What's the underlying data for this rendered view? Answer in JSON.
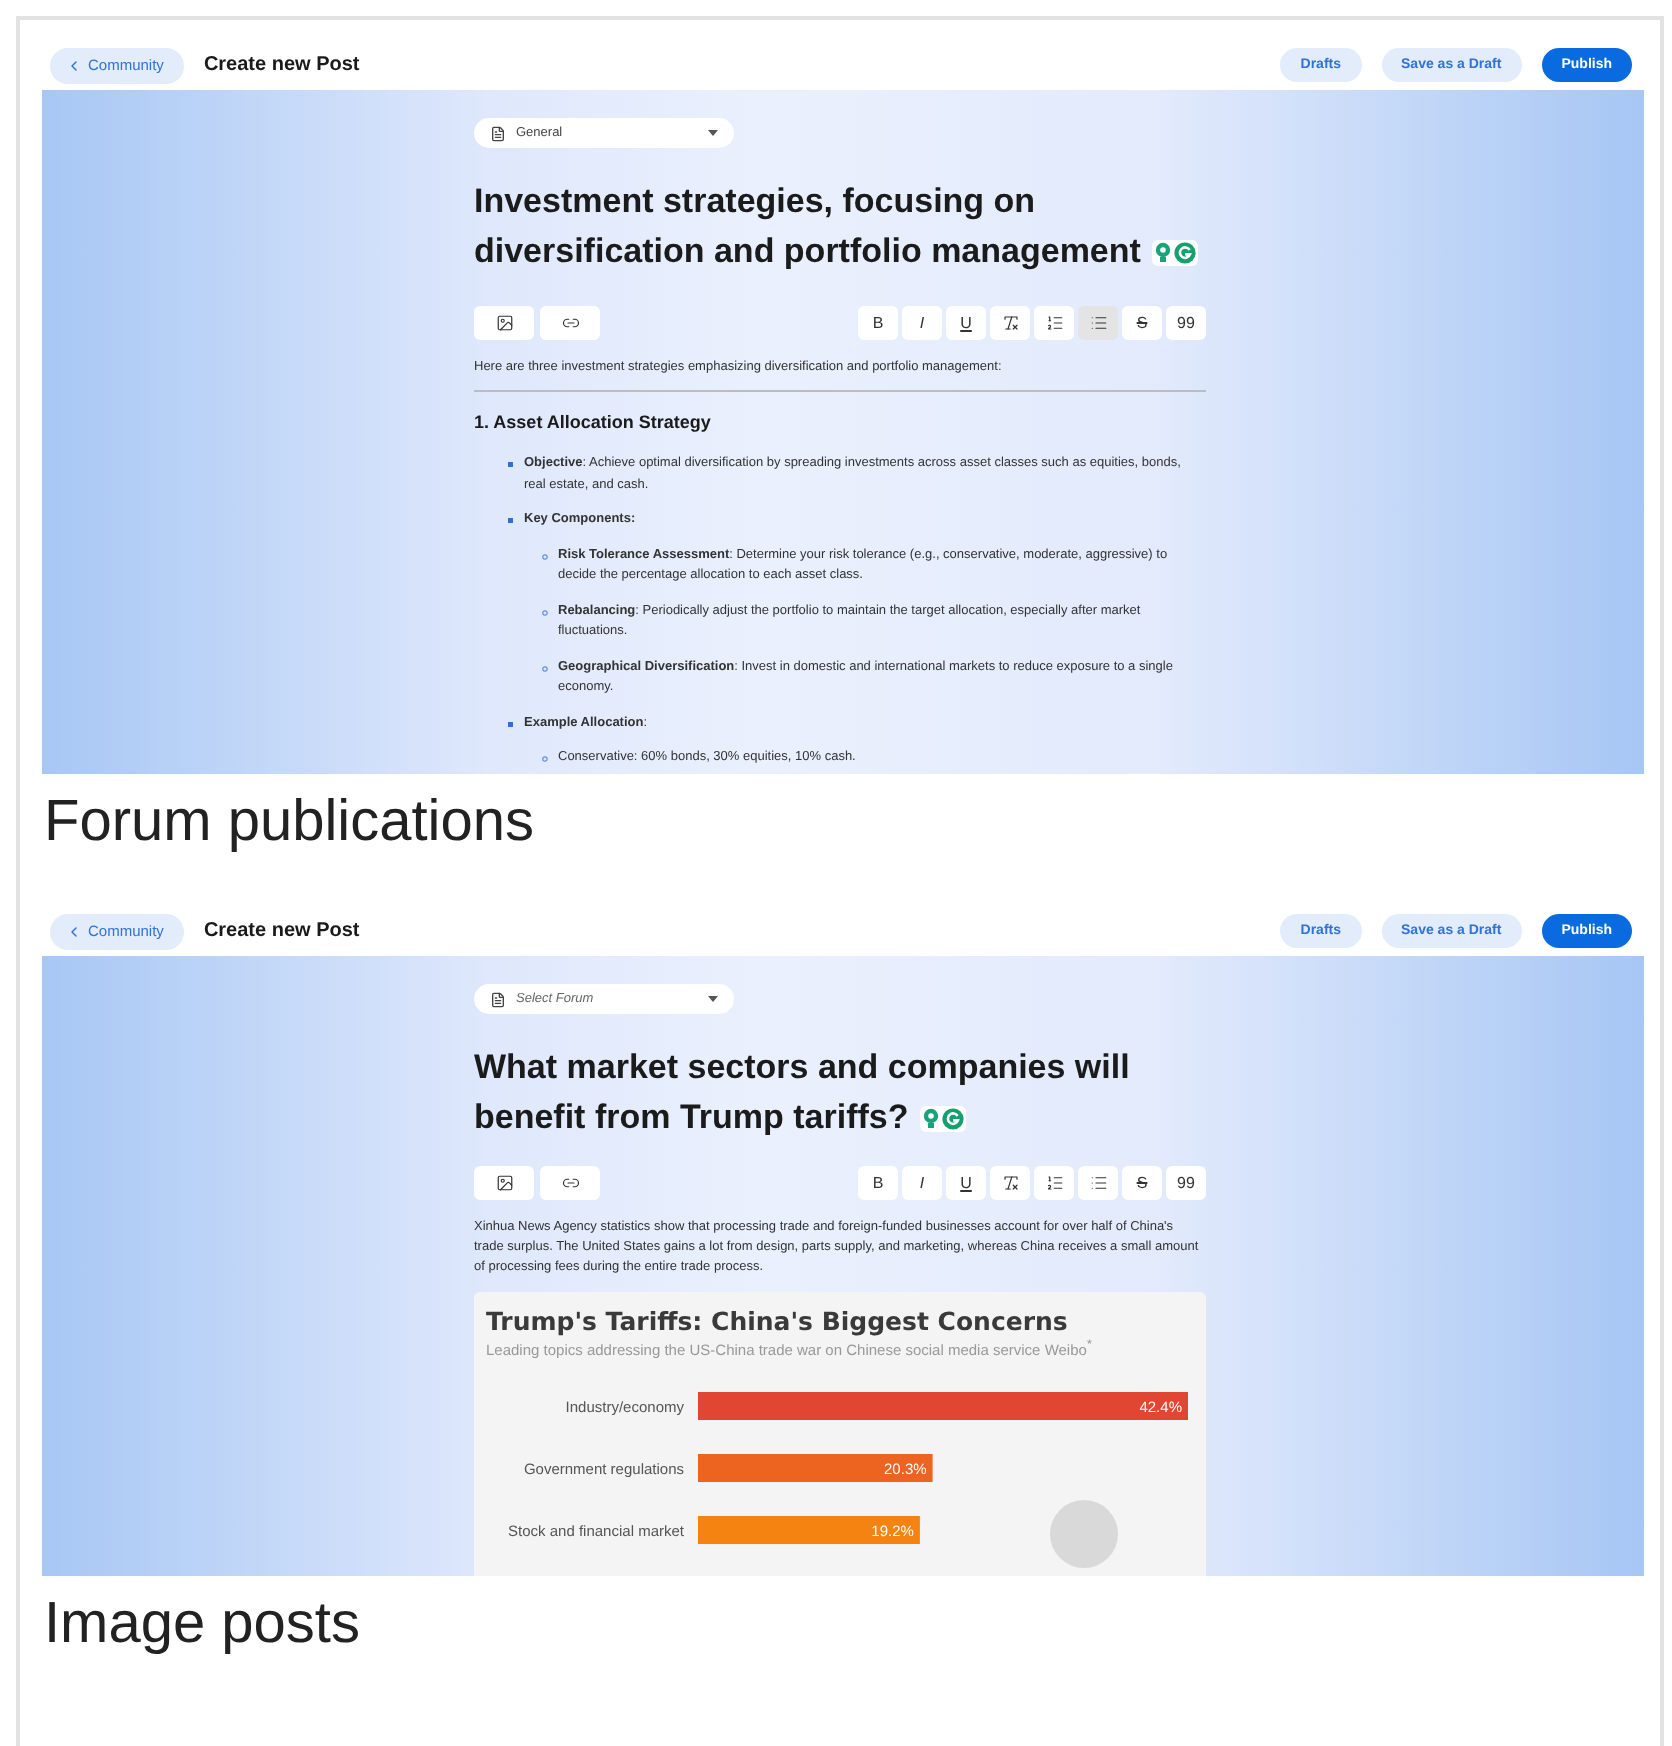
{
  "panels": [
    {
      "header": {
        "back_label": "Community",
        "title": "Create new Post",
        "buttons": [
          {
            "label": "Drafts",
            "kind": "secondary"
          },
          {
            "label": "Save as a Draft",
            "kind": "secondary"
          },
          {
            "label": "Publish",
            "kind": "primary"
          }
        ]
      },
      "forum_select": {
        "value": "General"
      },
      "post_title": "Investment strategies, focusing on diversification and portfolio management",
      "insert_tools": [
        {
          "kind": "image"
        },
        {
          "kind": "link"
        }
      ],
      "format_tools": [
        {
          "kind": "bold",
          "label": "B",
          "active": false
        },
        {
          "kind": "italic",
          "label": "I",
          "active": false
        },
        {
          "kind": "underline",
          "label": "U",
          "active": false
        },
        {
          "kind": "clear-format",
          "active": false
        },
        {
          "kind": "ordered-list",
          "active": false
        },
        {
          "kind": "bullet-list",
          "active": true
        },
        {
          "kind": "strike",
          "label": "S",
          "active": false
        },
        {
          "kind": "quote",
          "label": "99",
          "active": false
        }
      ],
      "body": [
        {
          "kind": "paragraph",
          "text": "Here are three investment strategies emphasizing diversification and portfolio management:"
        },
        {
          "kind": "rule"
        },
        {
          "kind": "heading",
          "text": "1. Asset Allocation Strategy"
        },
        {
          "kind": "list",
          "items": [
            {
              "text": "**Objective**: Achieve optimal diversification by spreading investments across asset classes such as equities, bonds, real estate, and cash."
            },
            {
              "text": "**Key Components:**",
              "children": [
                {
                  "text": "**Risk Tolerance Assessment**: Determine your risk tolerance (e.g., conservative, moderate, aggressive) to decide the percentage allocation to each asset class."
                },
                {
                  "text": "**Rebalancing**: Periodically adjust the portfolio to maintain the target allocation, especially after market fluctuations."
                },
                {
                  "text": "**Geographical Diversification**: Invest in domestic and international markets to reduce exposure to a single economy."
                }
              ]
            },
            {
              "text": "**Example Allocation**:",
              "children": [
                {
                  "text": "Conservative: 60% bonds, 30% equities, 10% cash."
                }
              ]
            }
          ]
        }
      ],
      "caption": "Forum publications"
    },
    {
      "header": {
        "back_label": "Community",
        "title": "Create new Post",
        "buttons": [
          {
            "label": "Drafts",
            "kind": "secondary"
          },
          {
            "label": "Save as a Draft",
            "kind": "secondary"
          },
          {
            "label": "Publish",
            "kind": "primary"
          }
        ]
      },
      "forum_select": {
        "placeholder": "Select Forum"
      },
      "post_title": "What market sectors and companies will benefit from Trump tariffs?",
      "insert_tools": [
        {
          "kind": "image"
        },
        {
          "kind": "link"
        }
      ],
      "format_tools": [
        {
          "kind": "bold",
          "label": "B",
          "active": false
        },
        {
          "kind": "italic",
          "label": "I",
          "active": false
        },
        {
          "kind": "underline",
          "label": "U",
          "active": false
        },
        {
          "kind": "clear-format",
          "active": false
        },
        {
          "kind": "ordered-list",
          "active": false
        },
        {
          "kind": "bullet-list",
          "active": false
        },
        {
          "kind": "strike",
          "label": "S",
          "active": false
        },
        {
          "kind": "quote",
          "label": "99",
          "active": false
        }
      ],
      "body": [
        {
          "kind": "paragraph",
          "text": "Xinhua News Agency statistics show that processing trade and foreign-funded businesses account for over half of China's trade surplus. The United States gains a lot from design, parts supply, and marketing, whereas China receives a small amount of processing fees during the entire trade process."
        },
        {
          "kind": "chart",
          "subtitle": "Leading topics addressing the US-China trade war on Chinese social media service Weibo$^{*}$",
          "chart_data": {
            "type": "bar",
            "orientation": "horizontal",
            "title": "Trump's Tariffs: China's Biggest Concerns",
            "categories": [
              "Industry/economy",
              "Government regulations",
              "Stock and financial market"
            ],
            "values": [
              42.4,
              20.3,
              19.2
            ],
            "value_labels": [
              "42.4%",
              "20.3%",
              "19.2%"
            ]
          }
        }
      ],
      "caption": "Image posts"
    }
  ]
}
